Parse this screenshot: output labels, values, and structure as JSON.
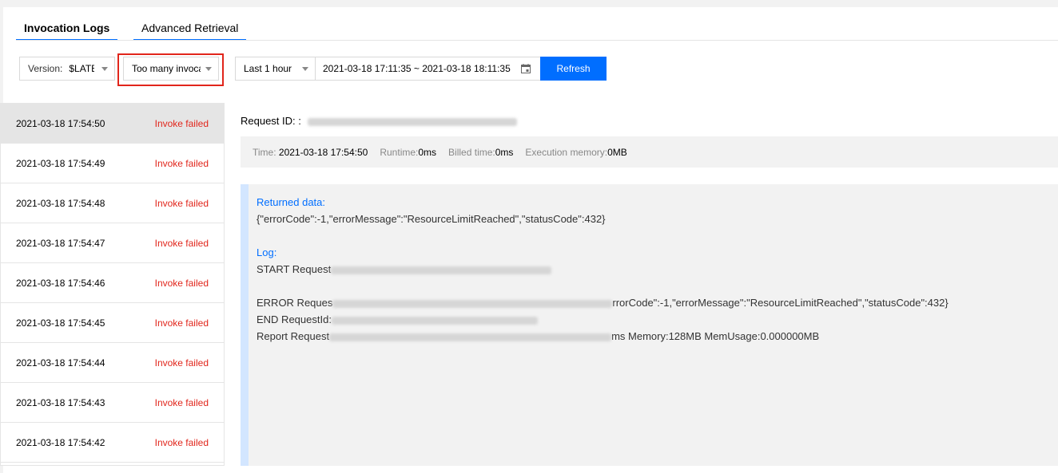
{
  "tabs": [
    {
      "label": "Invocation Logs",
      "active": true
    },
    {
      "label": "Advanced Retrieval",
      "active": false
    }
  ],
  "filters": {
    "version_label": "Version:",
    "version_value": "$LATEST",
    "status_value": "Too many invocations",
    "range_value": "Last 1 hour",
    "date_range": "2021-03-18 17:11:35 ~ 2021-03-18 18:11:35",
    "refresh_label": "Refresh"
  },
  "invocations": [
    {
      "time": "2021-03-18 17:54:50",
      "status": "Invoke failed",
      "selected": true
    },
    {
      "time": "2021-03-18 17:54:49",
      "status": "Invoke failed"
    },
    {
      "time": "2021-03-18 17:54:48",
      "status": "Invoke failed"
    },
    {
      "time": "2021-03-18 17:54:47",
      "status": "Invoke failed"
    },
    {
      "time": "2021-03-18 17:54:46",
      "status": "Invoke failed"
    },
    {
      "time": "2021-03-18 17:54:45",
      "status": "Invoke failed"
    },
    {
      "time": "2021-03-18 17:54:44",
      "status": "Invoke failed"
    },
    {
      "time": "2021-03-18 17:54:43",
      "status": "Invoke failed"
    },
    {
      "time": "2021-03-18 17:54:42",
      "status": "Invoke failed"
    }
  ],
  "detail": {
    "request_id_label": "Request ID: :",
    "time_label": "Time:",
    "time_value": "2021-03-18 17:54:50",
    "runtime_label": "Runtime:",
    "runtime_value": "0ms",
    "billed_label": "Billed time:",
    "billed_value": "0ms",
    "memory_label": "Execution memory:",
    "memory_value": "0MB",
    "returned_label": "Returned data:",
    "returned_value": "{\"errorCode\":-1,\"errorMessage\":\"ResourceLimitReached\",\"statusCode\":432}",
    "log_label": "Log:",
    "log_start": "START Request",
    "log_error_prefix": "ERROR Reques",
    "log_error_suffix": "rrorCode\":-1,\"errorMessage\":\"ResourceLimitReached\",\"statusCode\":432}",
    "log_end": "END RequestId:",
    "log_report_prefix": "Report Request",
    "log_report_suffix": "ms Memory:128MB MemUsage:0.000000MB"
  },
  "colors": {
    "accent": "#006eff",
    "error": "#e1251b",
    "highlight_box": "#e1251b"
  }
}
